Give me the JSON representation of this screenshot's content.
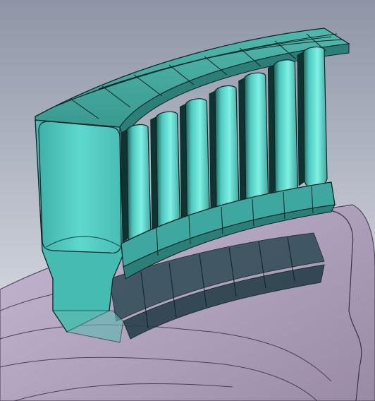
{
  "viewport": {
    "background_top": "#8e95a6",
    "background_bottom": "#e6e9ef"
  },
  "model": {
    "component": "turbine-vane-segment",
    "vane_count": 7,
    "body_color": "#4ec9bf",
    "body_highlight": "#7ff0e4",
    "body_shadow": "#2c7f79",
    "edge_color": "#0b2524",
    "disk_color": "#b8a4c8",
    "disk_edge": "#3c3347",
    "transparent_band_color": "#2f4a55"
  }
}
